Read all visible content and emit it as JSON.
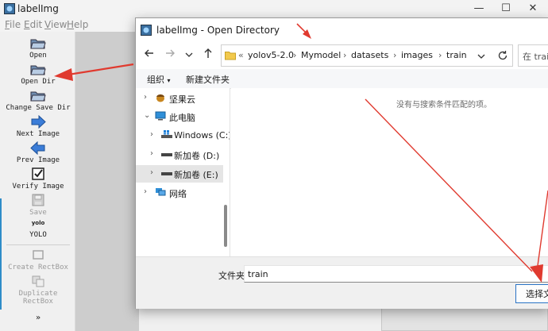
{
  "main_window": {
    "title": "labelImg",
    "menus": [
      {
        "label": "File",
        "key": "F",
        "rest": "ile"
      },
      {
        "label": "Edit",
        "key": "E",
        "rest": "dit"
      },
      {
        "label": "View",
        "key": "V",
        "rest": "iew"
      },
      {
        "label": "Help",
        "key": "H",
        "rest": "elp"
      }
    ],
    "controls": {
      "minimize": "—",
      "maximize": "☐",
      "close": "✕"
    },
    "toolbar": [
      {
        "label": "Open",
        "icon": "folder-open-icon",
        "enabled": true
      },
      {
        "label": "Open Dir",
        "icon": "folder-open-icon",
        "enabled": true
      },
      {
        "label": "Change Save Dir",
        "icon": "folder-open-icon",
        "enabled": true
      },
      {
        "label": "Next Image",
        "icon": "arrow-right-icon",
        "enabled": true
      },
      {
        "label": "Prev Image",
        "icon": "arrow-left-icon",
        "enabled": true
      },
      {
        "label": "Verify Image",
        "icon": "checkbox-icon",
        "enabled": true
      },
      {
        "label": "Save",
        "icon": "floppy-disk-icon",
        "enabled": false
      },
      {
        "label": "YOLO",
        "icon_text": "yolo",
        "icon": "yolo-format-icon",
        "enabled": true
      },
      {
        "label": "Create RectBox",
        "icon": "rect-box-icon",
        "enabled": false
      },
      {
        "label": "Duplicate RectBox",
        "icon": "duplicate-icon",
        "enabled": false
      }
    ],
    "more_tools": "»"
  },
  "dialog": {
    "title": "labelImg - Open Directory",
    "breadcrumb_overflow": "«",
    "breadcrumb": [
      "yolov5-2.0",
      "Mymodel",
      "datasets",
      "images",
      "train"
    ],
    "search_placeholder": "在 train",
    "commands": {
      "organize": "组织",
      "new_folder": "新建文件夹"
    },
    "tree": [
      {
        "label": "坚果云",
        "icon": "nutstore-icon",
        "level": 0,
        "chevron": "›",
        "selected": false
      },
      {
        "label": "此电脑",
        "icon": "computer-icon",
        "level": 0,
        "chevron": "⌄",
        "selected": false
      },
      {
        "label": "Windows (C:)",
        "icon": "windows-drive-icon",
        "level": 1,
        "chevron": "›",
        "selected": false
      },
      {
        "label": "新加卷 (D:)",
        "icon": "drive-icon",
        "level": 1,
        "chevron": "›",
        "selected": false
      },
      {
        "label": "新加卷 (E:)",
        "icon": "drive-icon",
        "level": 1,
        "chevron": "›",
        "selected": true
      },
      {
        "label": "网络",
        "icon": "network-icon",
        "level": 0,
        "chevron": "›",
        "selected": false
      }
    ],
    "empty_message": "没有与搜索条件匹配的项。",
    "folder_label": "文件夹:",
    "folder_value": "train",
    "select_button": "选择文"
  },
  "colors": {
    "annotation_arrow": "#e03a2f",
    "accent": "#2a73c5",
    "folder": "#f2c94c"
  }
}
